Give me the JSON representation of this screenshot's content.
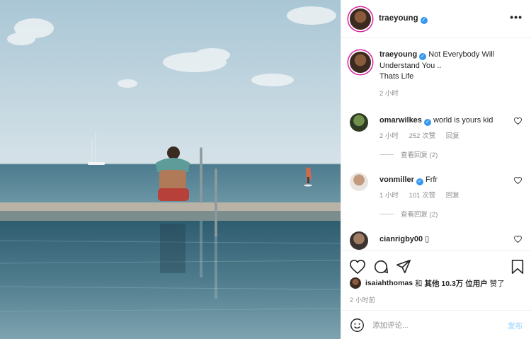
{
  "post": {
    "author": "traeyoung",
    "author_verified": true,
    "caption_line1": "Not Everybody Will",
    "caption_line2": "Understand You ..",
    "caption_line3": "Thats Life",
    "caption_time": "2 小时"
  },
  "comments": [
    {
      "user": "omarwilkes",
      "verified": true,
      "text": "world is yours kid",
      "time": "2 小时",
      "likes": "252 次赞",
      "reply": "回复",
      "view_replies": "查看回复 (2)"
    },
    {
      "user": "vonmiller",
      "verified": true,
      "text": "Frfr",
      "time": "1 小时",
      "likes": "101 次赞",
      "reply": "回复",
      "view_replies": "查看回复 (2)"
    },
    {
      "user": "cianrigby00",
      "verified": false,
      "text": "▯"
    }
  ],
  "likes_line": {
    "user": "isaiahthomas",
    "and": "和",
    "others": "其他 10.3万 位用户",
    "liked": "赞了"
  },
  "post_time": "2 小时前",
  "add_comment": {
    "placeholder": "添加评论...",
    "post_label": "发布"
  },
  "icons": [
    "more-icon",
    "heart-icon",
    "comment-icon",
    "share-icon",
    "bookmark-icon",
    "emoji-icon",
    "verified-icon"
  ],
  "colors": {
    "link_blue": "#3897f0",
    "disabled_blue": "#b2dffc",
    "meta_gray": "#8e8e8e",
    "story_ring": "#d6249f"
  }
}
